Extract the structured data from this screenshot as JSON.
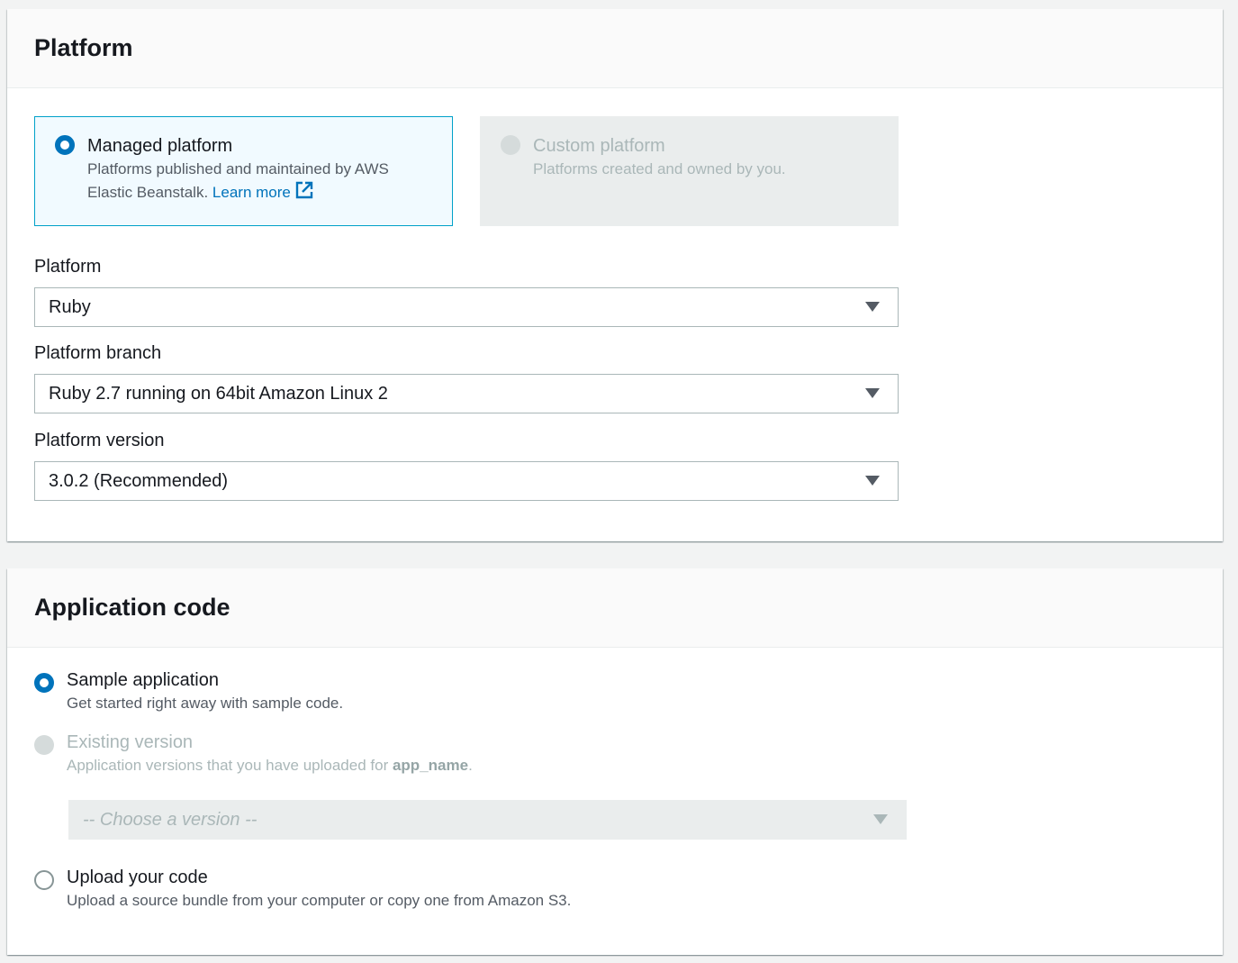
{
  "platform_panel": {
    "title": "Platform",
    "tiles": [
      {
        "label": "Managed platform",
        "desc_line1": "Platforms published and maintained by AWS",
        "desc_line2": "Elastic Beanstalk.",
        "link": "Learn more"
      },
      {
        "label": "Custom platform",
        "desc": "Platforms created and owned by you."
      }
    ],
    "fields": {
      "platform": {
        "label": "Platform",
        "value": "Ruby"
      },
      "branch": {
        "label": "Platform branch",
        "value": "Ruby 2.7 running on 64bit Amazon Linux 2"
      },
      "version": {
        "label": "Platform version",
        "value": "3.0.2 (Recommended)"
      }
    }
  },
  "appcode_panel": {
    "title": "Application code",
    "options": [
      {
        "label": "Sample application",
        "desc": "Get started right away with sample code."
      },
      {
        "label": "Existing version",
        "desc": "Application versions that you have uploaded for",
        "app_name": "app_name",
        "desc_end": "."
      },
      {
        "label": "Upload your code",
        "desc": "Upload a source bundle from your computer or copy one from Amazon S3."
      }
    ],
    "version_select": {
      "placeholder": "-- Choose a version --"
    }
  },
  "colors": {
    "accent": "#0073bb",
    "link": "#0073bb",
    "disabled": "#aab7b8"
  }
}
